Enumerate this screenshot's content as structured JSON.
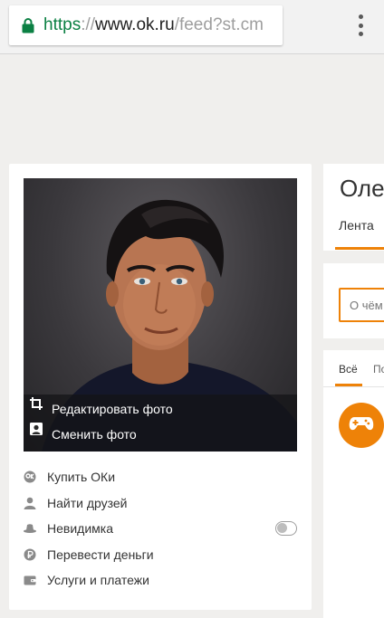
{
  "browser": {
    "url_scheme": "https",
    "url_separator": "://",
    "url_host": "www.ok.ru",
    "url_path": "/feed?st.cm"
  },
  "profile": {
    "photo_actions": {
      "edit": "Редактировать фото",
      "change": "Сменить фото"
    },
    "menu": [
      {
        "label": "Купить ОКи",
        "icon": "ok-coins-icon"
      },
      {
        "label": "Найти друзей",
        "icon": "person-icon"
      },
      {
        "label": "Невидимка",
        "icon": "hat-icon",
        "toggle": false
      },
      {
        "label": "Перевести деньги",
        "icon": "ruble-icon"
      },
      {
        "label": "Услуги и платежи",
        "icon": "wallet-icon"
      }
    ]
  },
  "user": {
    "name": "Оле"
  },
  "tabs": {
    "feed": "Лента"
  },
  "post": {
    "placeholder": "О чём"
  },
  "feed_filters": {
    "all": "Всё",
    "next": "По"
  },
  "colors": {
    "accent": "#ee8208",
    "secure_url": "#0b8043"
  }
}
